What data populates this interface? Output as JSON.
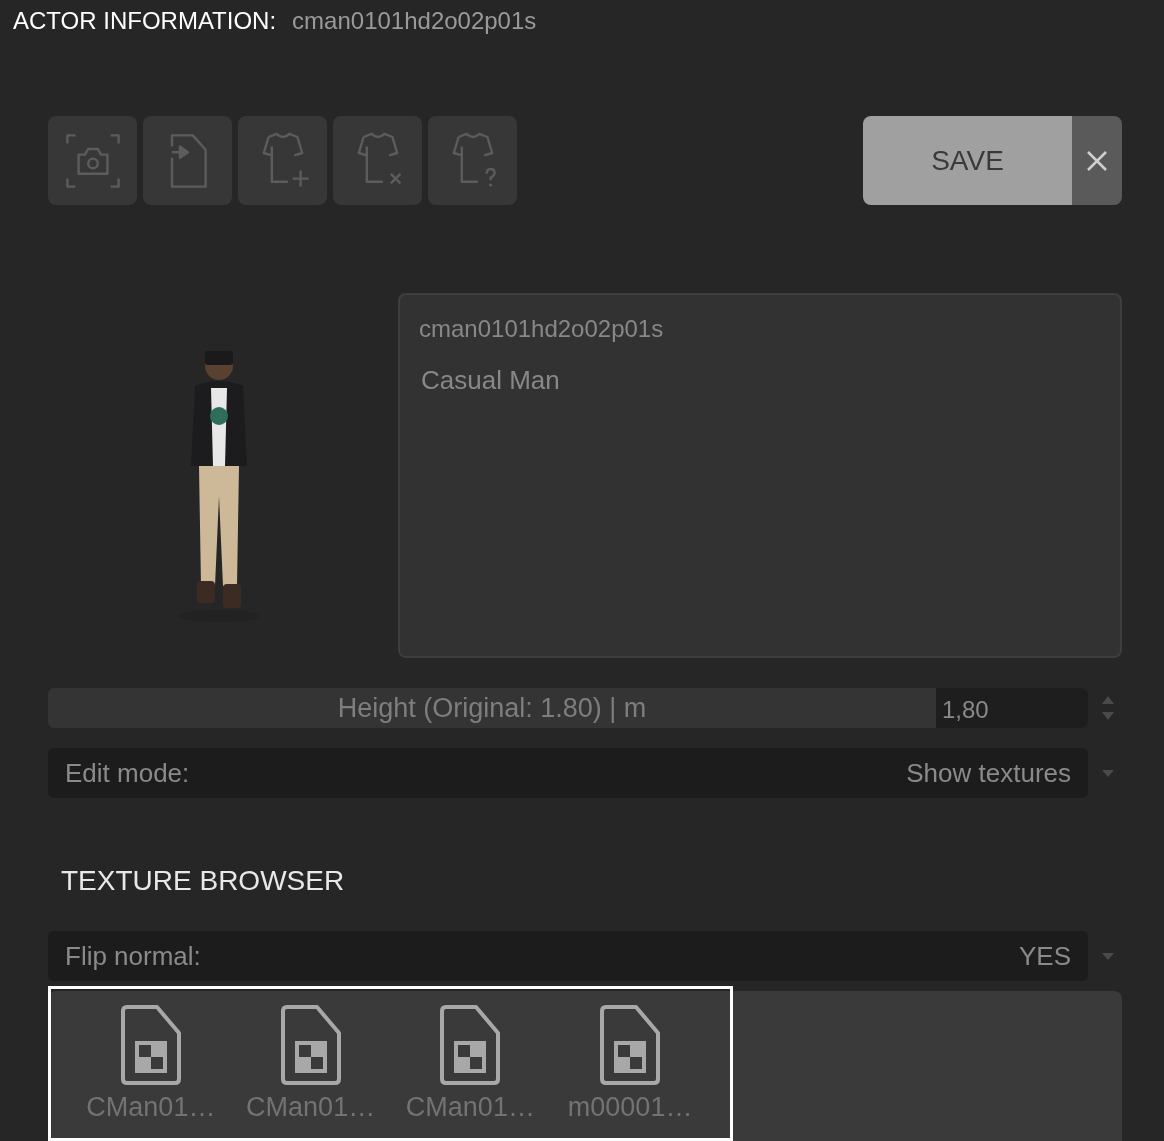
{
  "header": {
    "label": "ACTOR INFORMATION:",
    "value": "cman0101hd2o02p01s"
  },
  "toolbar": [
    {
      "kind": "camera"
    },
    {
      "kind": "import"
    },
    {
      "kind": "add"
    },
    {
      "kind": "remove"
    },
    {
      "kind": "help"
    }
  ],
  "save_button": {
    "label": "SAVE"
  },
  "info": {
    "id": "cman0101hd2o02p01s",
    "name": "Casual Man"
  },
  "height": {
    "label": "Height (Original: 1.80) | m",
    "value": "1,80"
  },
  "edit_mode": {
    "label": "Edit mode:",
    "value": "Show textures"
  },
  "texture_browser": {
    "title": "TEXTURE BROWSER",
    "flip_normal": {
      "label": "Flip normal:",
      "value": "YES"
    },
    "textures": [
      {
        "name": "CMan01…"
      },
      {
        "name": "CMan01…"
      },
      {
        "name": "CMan01…"
      },
      {
        "name": "m00001…"
      }
    ]
  }
}
